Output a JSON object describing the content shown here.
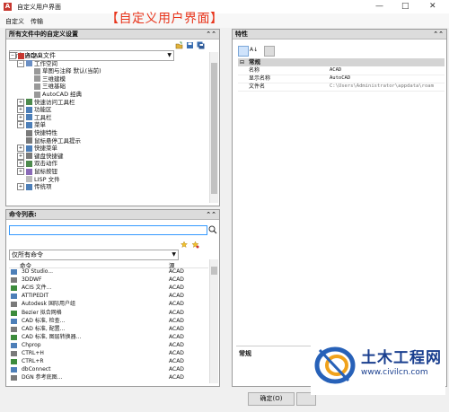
{
  "window": {
    "title": "自定义用户界面",
    "controls": {
      "minimize": "—",
      "maximize": "□",
      "close": "✕"
    }
  },
  "menu": {
    "items": [
      "自定义",
      "传输"
    ]
  },
  "caption": "【自定义用户界面】",
  "left_top": {
    "header": "所有文件中的自定义设置",
    "collapse": "⌃⌃",
    "combo_value": "所有自定义文件",
    "tree": [
      {
        "label": "ACAD",
        "level": 0,
        "exp": "−"
      },
      {
        "label": "工作空间",
        "level": 1,
        "exp": "−"
      },
      {
        "label": "草图与注释 默认(当前)",
        "level": 2,
        "exp": ""
      },
      {
        "label": "三维建模",
        "level": 2,
        "exp": ""
      },
      {
        "label": "三维基础",
        "level": 2,
        "exp": ""
      },
      {
        "label": "AutoCAD 经典",
        "level": 2,
        "exp": ""
      },
      {
        "label": "快速访问工具栏",
        "level": 1,
        "exp": "+"
      },
      {
        "label": "功能区",
        "level": 1,
        "exp": "+"
      },
      {
        "label": "工具栏",
        "level": 1,
        "exp": "+"
      },
      {
        "label": "菜单",
        "level": 1,
        "exp": "+"
      },
      {
        "label": "快捷特性",
        "level": 1,
        "exp": ""
      },
      {
        "label": "鼠标悬停工具提示",
        "level": 1,
        "exp": ""
      },
      {
        "label": "快捷菜单",
        "level": 1,
        "exp": "+"
      },
      {
        "label": "键盘快捷键",
        "level": 1,
        "exp": "+"
      },
      {
        "label": "双击动作",
        "level": 1,
        "exp": "+"
      },
      {
        "label": "鼠标按钮",
        "level": 1,
        "exp": "+"
      },
      {
        "label": "LISP 文件",
        "level": 1,
        "exp": ""
      },
      {
        "label": "传统项",
        "level": 1,
        "exp": "+"
      }
    ]
  },
  "left_bottom": {
    "header": "命令列表:",
    "collapse": "⌃⌃",
    "search_value": "",
    "filter_value": "仅所有命令",
    "col_command": "命令",
    "col_source": "源",
    "rows": [
      {
        "name": "3D Studio...",
        "src": "ACAD"
      },
      {
        "name": "3DDWF",
        "src": "ACAD"
      },
      {
        "name": "ACIS 文件...",
        "src": "ACAD"
      },
      {
        "name": "ATTIPEDIT",
        "src": "ACAD"
      },
      {
        "name": "Autodesk 国际用户组",
        "src": "ACAD"
      },
      {
        "name": "Bezier 拟合网格",
        "src": "ACAD"
      },
      {
        "name": "CAD 标准, 检查...",
        "src": "ACAD"
      },
      {
        "name": "CAD 标准, 配置...",
        "src": "ACAD"
      },
      {
        "name": "CAD 标准, 图层转换器...",
        "src": "ACAD"
      },
      {
        "name": "Chprop",
        "src": "ACAD"
      },
      {
        "name": "CTRL+H",
        "src": "ACAD"
      },
      {
        "name": "CTRL+R",
        "src": "ACAD"
      },
      {
        "name": "dbConnect",
        "src": "ACAD"
      },
      {
        "name": "DGN 参考底图...",
        "src": "ACAD"
      }
    ]
  },
  "right": {
    "header": "特性",
    "collapse": "⌃⌃",
    "group": "常规",
    "props": [
      {
        "key": "名称",
        "val": "ACAD"
      },
      {
        "key": "显示名称",
        "val": "AutoCAD"
      },
      {
        "key": "文件名",
        "val": "C:\\Users\\Administrator\\appdata\\roam"
      }
    ],
    "desc_title": "常规"
  },
  "footer": {
    "ok_label": "确定(O)"
  },
  "watermark": {
    "brand": "土木工程网",
    "url": "www.civilcn.com"
  },
  "colors": {
    "caption": "#e8341b",
    "watermark_text": "#1a3f8f"
  }
}
